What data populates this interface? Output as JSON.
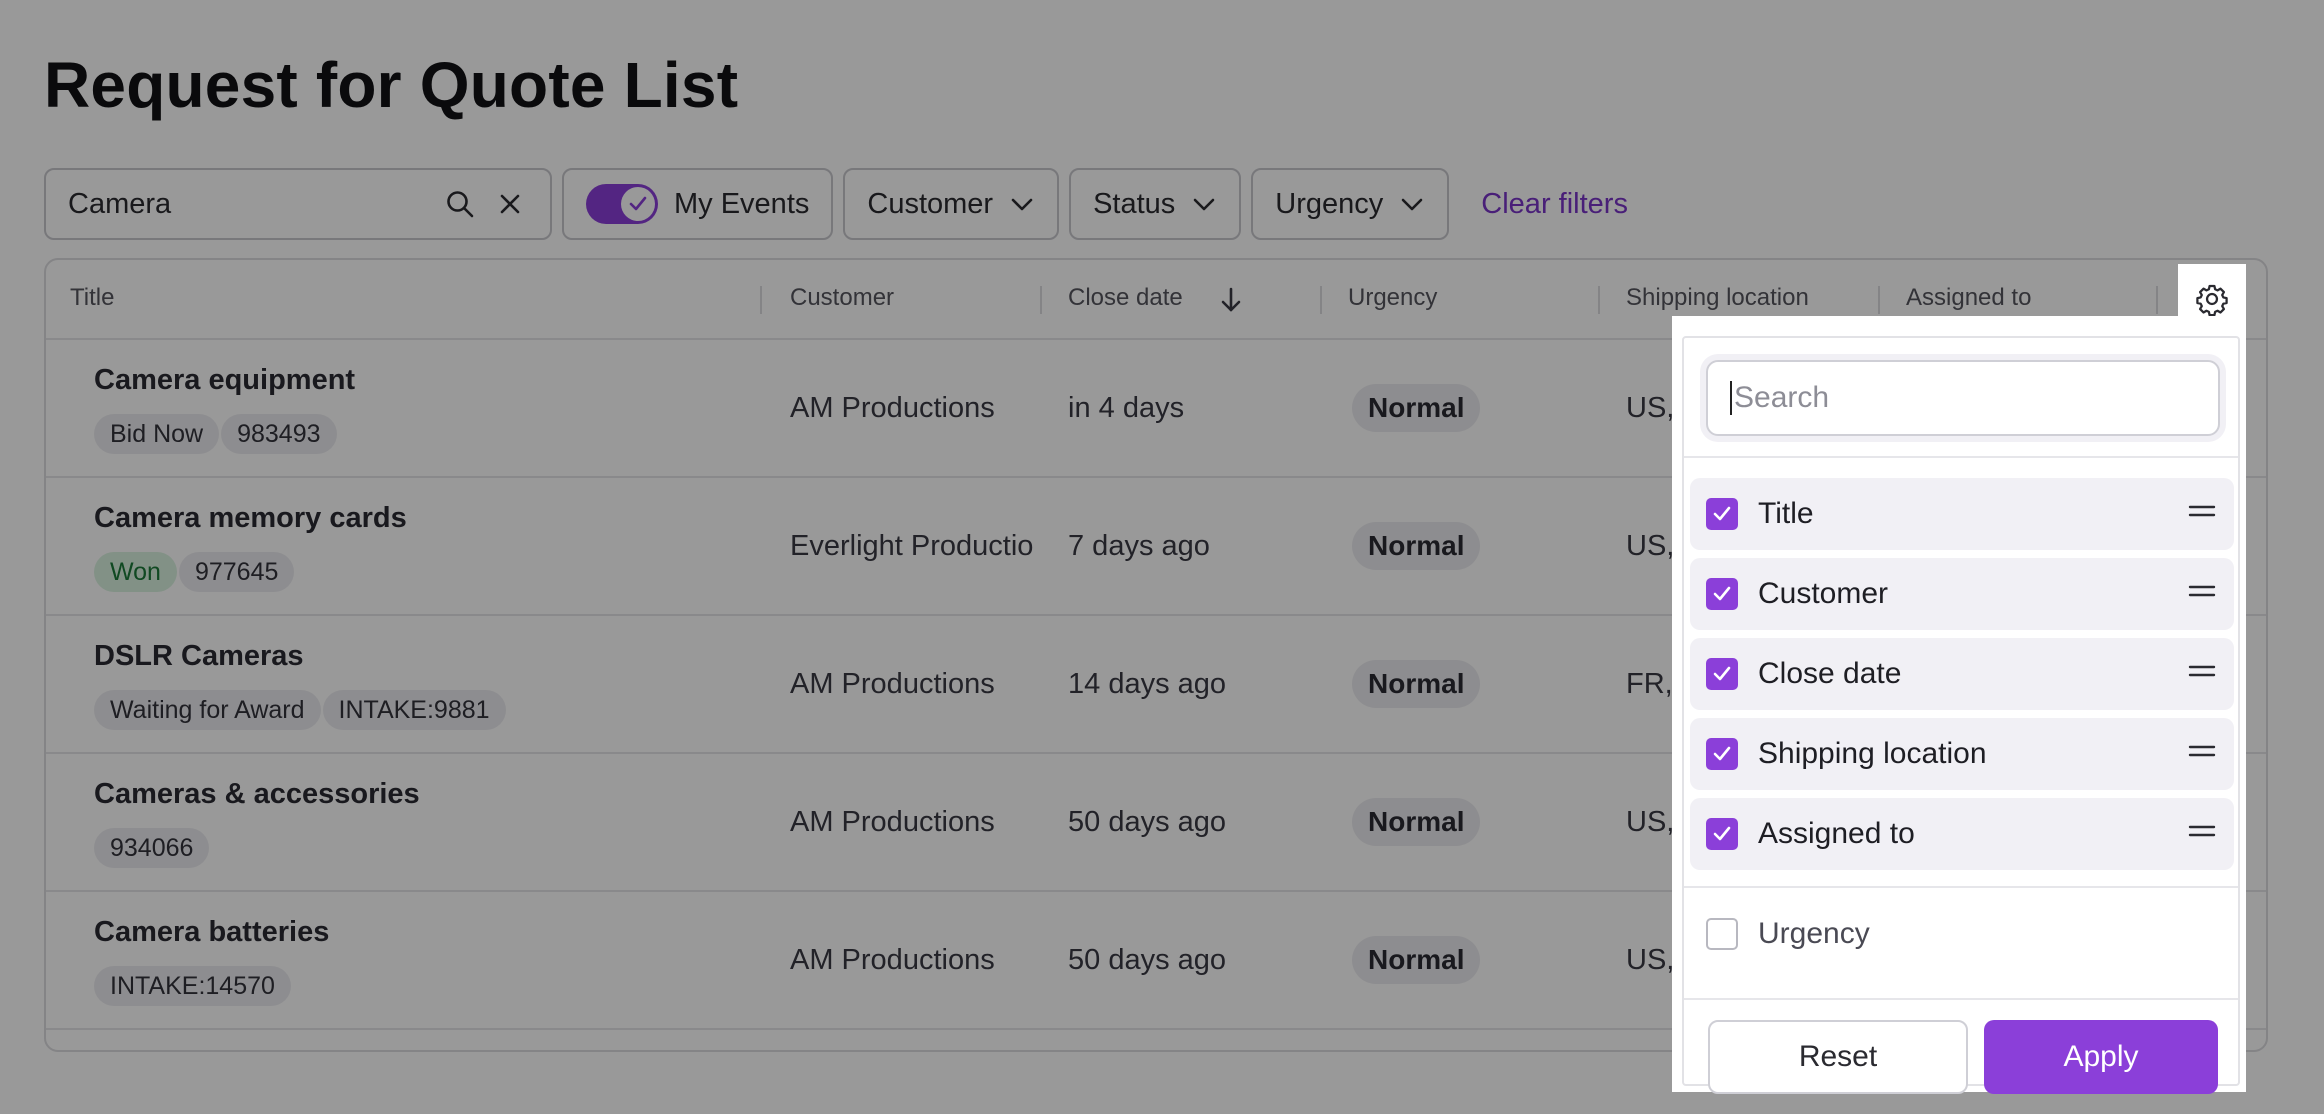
{
  "page": {
    "title": "Request for Quote List"
  },
  "filters": {
    "search_value": "Camera",
    "my_events_label": "My Events",
    "my_events_on": true,
    "customer_label": "Customer",
    "status_label": "Status",
    "urgency_label": "Urgency",
    "clear_label": "Clear filters"
  },
  "table": {
    "headers": {
      "title": "Title",
      "customer": "Customer",
      "close_date": "Close date",
      "urgency": "Urgency",
      "shipping": "Shipping location",
      "assigned": "Assigned to"
    },
    "rows": [
      {
        "title": "Camera equipment",
        "tag1": "Bid Now",
        "tag2": "983493",
        "customer": "AM Productions",
        "close": "in 4 days",
        "urgency": "Normal",
        "shipping": "US,"
      },
      {
        "title": "Camera memory cards",
        "tag1": "Won",
        "tag2": "977645",
        "customer": "Everlight Productio",
        "close": "7 days ago",
        "urgency": "Normal",
        "shipping": "US,"
      },
      {
        "title": "DSLR Cameras",
        "tag1": "Waiting for Award",
        "tag2": "INTAKE:9881",
        "customer": "AM Productions",
        "close": "14 days ago",
        "urgency": "Normal",
        "shipping": "FR, I"
      },
      {
        "title": "Cameras & accessories",
        "tag1": "934066",
        "customer": "AM Productions",
        "close": "50 days ago",
        "urgency": "Normal",
        "shipping": "US,"
      },
      {
        "title": "Camera batteries",
        "tag1": "INTAKE:14570",
        "customer": "AM Productions",
        "close": "50 days ago",
        "urgency": "Normal",
        "shipping": "US,"
      }
    ]
  },
  "column_settings": {
    "search_placeholder": "Search",
    "selected": [
      "Title",
      "Customer",
      "Close date",
      "Shipping location",
      "Assigned to"
    ],
    "unselected": [
      "Urgency"
    ],
    "reset_label": "Reset",
    "apply_label": "Apply"
  },
  "colors": {
    "accent": "#8b3fd9",
    "link": "#7a35c8",
    "won_bg": "#d9f2df",
    "won_text": "#1b7a3a"
  }
}
